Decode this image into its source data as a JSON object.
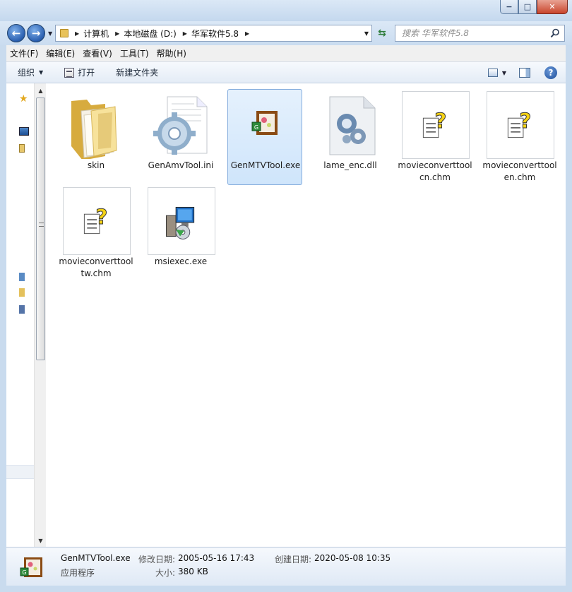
{
  "titlebar": {
    "min": "−",
    "max": "□",
    "close": "✕"
  },
  "nav": {
    "back": "←",
    "forward": "→"
  },
  "breadcrumb": [
    "计算机",
    "本地磁盘 (D:)",
    "华军软件5.8"
  ],
  "search": {
    "placeholder": "搜索 华军软件5.8"
  },
  "menu": [
    "文件(F)",
    "编辑(E)",
    "查看(V)",
    "工具(T)",
    "帮助(H)"
  ],
  "toolbar": {
    "organize": "组织",
    "open": "打开",
    "new_folder": "新建文件夹"
  },
  "files": [
    {
      "name": "skin",
      "kind": "folder"
    },
    {
      "name": "GenAmvTool.ini",
      "kind": "ini"
    },
    {
      "name": "GenMTVTool.exe",
      "kind": "exe-mtv",
      "selected": true
    },
    {
      "name": "lame_enc.dll",
      "kind": "dll"
    },
    {
      "name": "movieconverttoolcn.chm",
      "kind": "chm"
    },
    {
      "name": "movieconverttoolen.chm",
      "kind": "chm"
    },
    {
      "name": "movieconverttooltw.chm",
      "kind": "chm"
    },
    {
      "name": "msiexec.exe",
      "kind": "exe-msi"
    }
  ],
  "details": {
    "name": "GenMTVTool.exe",
    "type": "应用程序",
    "modified_label": "修改日期:",
    "modified_value": "2005-05-16 17:43",
    "created_label": "创建日期:",
    "created_value": "2020-05-08 10:35",
    "size_label": "大小:",
    "size_value": "380 KB"
  }
}
